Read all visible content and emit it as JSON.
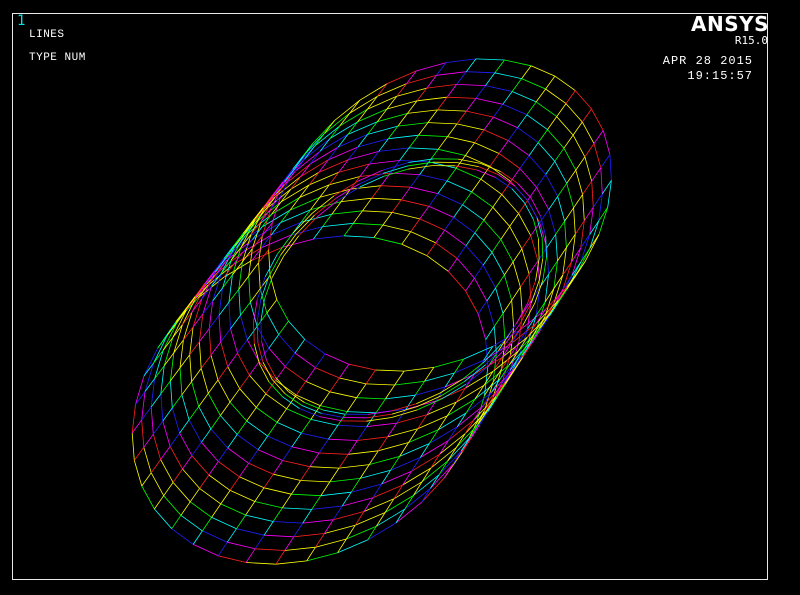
{
  "window": {
    "number": "1"
  },
  "plot_info": {
    "line1": "LINES",
    "line2": "TYPE NUM"
  },
  "branding": {
    "name": "ANSYS",
    "version": "R15.0"
  },
  "timestamp": {
    "date": "APR 28 2015",
    "time": "19:15:57"
  },
  "mesh": {
    "description_colors": [
      "#ff2020",
      "#ffff00",
      "#00ff00",
      "#00ffff",
      "#2020ff",
      "#ff00ff",
      "#ffffff"
    ]
  }
}
